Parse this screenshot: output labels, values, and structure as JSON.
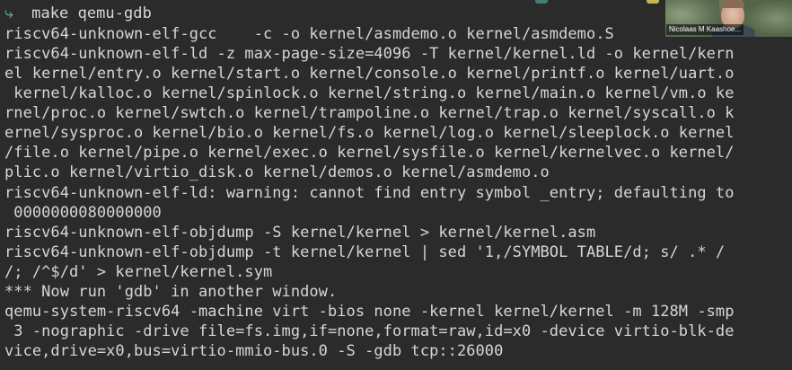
{
  "terminal": {
    "prompt_symbol": "⤷",
    "command": "make qemu-gdb",
    "lines": [
      "riscv64-unknown-elf-gcc    -c -o kernel/asmdemo.o kernel/asmdemo.S",
      "riscv64-unknown-elf-ld -z max-page-size=4096 -T kernel/kernel.ld -o kernel/kern",
      "el kernel/entry.o kernel/start.o kernel/console.o kernel/printf.o kernel/uart.o",
      " kernel/kalloc.o kernel/spinlock.o kernel/string.o kernel/main.o kernel/vm.o ke",
      "rnel/proc.o kernel/swtch.o kernel/trampoline.o kernel/trap.o kernel/syscall.o k",
      "ernel/sysproc.o kernel/bio.o kernel/fs.o kernel/log.o kernel/sleeplock.o kernel",
      "/file.o kernel/pipe.o kernel/exec.o kernel/sysfile.o kernel/kernelvec.o kernel/",
      "plic.o kernel/virtio_disk.o kernel/demos.o kernel/asmdemo.o",
      "riscv64-unknown-elf-ld: warning: cannot find entry symbol _entry; defaulting to",
      " 0000000080000000",
      "riscv64-unknown-elf-objdump -S kernel/kernel > kernel/kernel.asm",
      "riscv64-unknown-elf-objdump -t kernel/kernel | sed '1,/SYMBOL TABLE/d; s/ .* /",
      "/; /^$/d' > kernel/kernel.sym",
      "*** Now run 'gdb' in another window.",
      "qemu-system-riscv64 -machine virt -bios none -kernel kernel/kernel -m 128M -smp",
      " 3 -nographic -drive file=fs.img,if=none,format=raw,id=x0 -device virtio-blk-de",
      "vice,drive=x0,bus=virtio-mmio-bus.0 -S -gdb tcp::26000"
    ]
  },
  "webcam": {
    "participant_name": "Nicolaas M Kaashoe..."
  },
  "colors": {
    "background": "#2b2b2b",
    "foreground": "#d6d6d6",
    "prompt_accent": "#5fc9b8"
  }
}
